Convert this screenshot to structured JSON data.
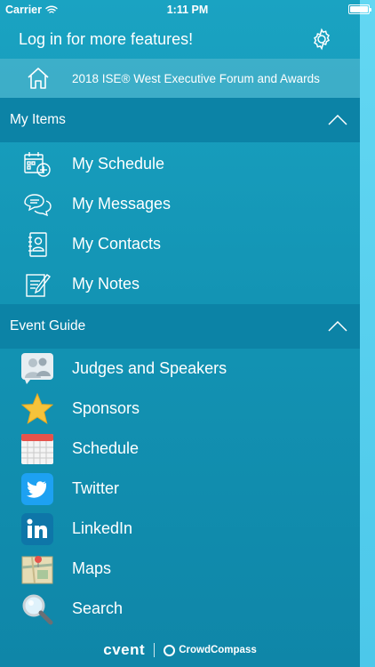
{
  "status_bar": {
    "carrier": "Carrier",
    "time": "1:11 PM"
  },
  "header": {
    "title": "Log in for more features!"
  },
  "event": {
    "label": "2018 ISE® West Executive Forum and Awards"
  },
  "my_items": {
    "title": "My Items",
    "items": [
      {
        "label": "My Schedule",
        "icon": "calendar-add-icon"
      },
      {
        "label": "My Messages",
        "icon": "chat-bubbles-icon"
      },
      {
        "label": "My Contacts",
        "icon": "contact-book-icon"
      },
      {
        "label": "My Notes",
        "icon": "notepad-pencil-icon"
      }
    ]
  },
  "event_guide": {
    "title": "Event Guide",
    "items": [
      {
        "label": "Judges and Speakers",
        "icon": "people-icon"
      },
      {
        "label": "Sponsors",
        "icon": "star-icon"
      },
      {
        "label": "Schedule",
        "icon": "calendar-icon"
      },
      {
        "label": "Twitter",
        "icon": "twitter-icon"
      },
      {
        "label": "LinkedIn",
        "icon": "linkedin-icon"
      },
      {
        "label": "Maps",
        "icon": "map-icon"
      },
      {
        "label": "Search",
        "icon": "magnifier-icon"
      }
    ]
  },
  "footer": {
    "brand1": "cvent",
    "brand2": "CrowdCompass"
  },
  "colors": {
    "drawer": "#1394b4",
    "section_header": "#0c83a6",
    "right_strip": "#5fd2ee",
    "star": "#f5c33b",
    "twitter": "#1da1f2",
    "linkedin": "#0e76a8"
  }
}
